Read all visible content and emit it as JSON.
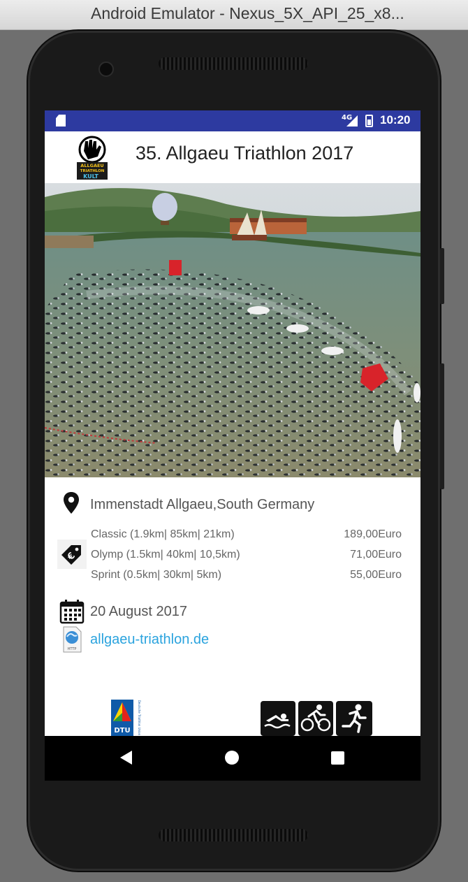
{
  "window": {
    "title": "Android Emulator - Nexus_5X_API_25_x8..."
  },
  "status_bar": {
    "network": "4G",
    "time": "10:20"
  },
  "header": {
    "title": "35. Allgaeu Triathlon 2017",
    "logo_text": [
      "ALLGAEU",
      "TRIATHLON",
      "KULT"
    ]
  },
  "event": {
    "location": "Immenstadt Allgaeu,South Germany",
    "prices": [
      {
        "name": "Classic (1.9km| 85km| 21km)",
        "price": "189,00Euro"
      },
      {
        "name": "Olymp (1.5km| 40km| 10,5km)",
        "price": "71,00Euro"
      },
      {
        "name": "Sprint (0.5km| 30km| 5km)",
        "price": "55,00Euro"
      }
    ],
    "date": "20 August 2017",
    "website": "allgaeu-triathlon.de"
  },
  "footer": {
    "dtu_label": "DTU",
    "dtu_side_text": "Deutsche Triathlon Union"
  },
  "icons": [
    "sd-card-icon",
    "signal-icon",
    "battery-icon",
    "location-pin-icon",
    "price-tag-icon",
    "calendar-icon",
    "web-http-icon",
    "swim-icon",
    "bike-icon",
    "run-icon",
    "back-icon",
    "home-icon",
    "recents-icon"
  ],
  "colors": {
    "status_bar": "#2d3aa0",
    "link": "#2aa3de",
    "nav_bar": "#000000"
  }
}
